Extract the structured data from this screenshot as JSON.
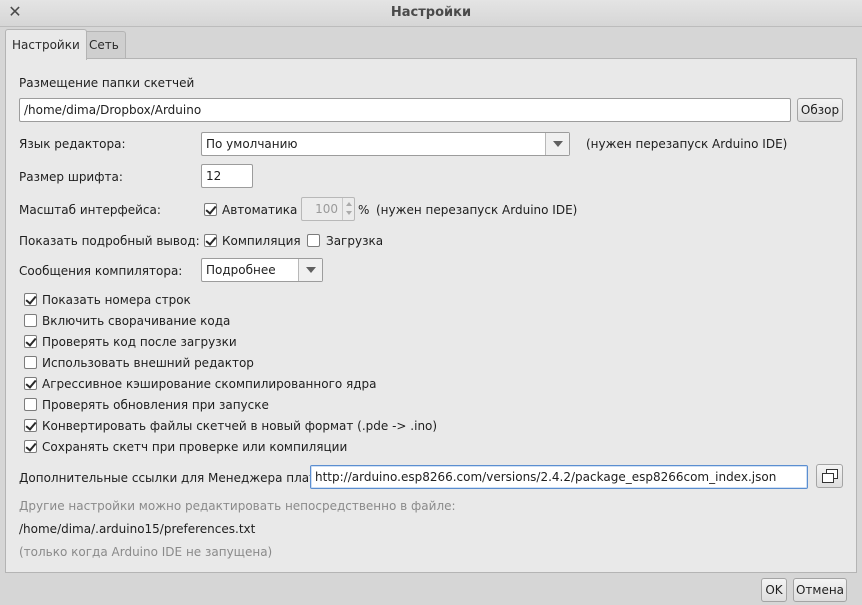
{
  "window": {
    "title": "Настройки"
  },
  "tabs": [
    {
      "label": "Настройки"
    },
    {
      "label": "Сеть"
    }
  ],
  "sketchbook": {
    "label": "Размещение папки скетчей",
    "path": "/home/dima/Dropbox/Arduino",
    "browse_label": "Обзор"
  },
  "editor_language": {
    "label": "Язык редактора:",
    "value": "По умолчанию",
    "note": "(нужен перезапуск Arduino IDE)"
  },
  "font_size": {
    "label": "Размер шрифта:",
    "value": "12"
  },
  "ui_scale": {
    "label": "Масштаб интерфейса:",
    "auto_label": "Автоматика",
    "auto_checked": true,
    "value": "100",
    "unit": "%",
    "note": "(нужен перезапуск Arduino IDE)"
  },
  "verbose": {
    "label": "Показать подробный вывод:",
    "compile_label": "Компиляция",
    "compile_checked": true,
    "upload_label": "Загрузка",
    "upload_checked": false
  },
  "compiler_warnings": {
    "label": "Сообщения компилятора:",
    "value": "Подробнее"
  },
  "options": [
    {
      "label": "Показать номера строк",
      "checked": true
    },
    {
      "label": "Включить сворачивание кода",
      "checked": false
    },
    {
      "label": "Проверять код после загрузки",
      "checked": true
    },
    {
      "label": "Использовать внешний редактор",
      "checked": false
    },
    {
      "label": "Агрессивное кэширование скомпилированного ядра",
      "checked": true
    },
    {
      "label": "Проверять обновления при запуске",
      "checked": false
    },
    {
      "label": "Конвертировать файлы скетчей в новый формат (.pde -> .ino)",
      "checked": true
    },
    {
      "label": "Сохранять скетч при проверке или компиляции",
      "checked": true
    }
  ],
  "board_urls": {
    "label": "Дополнительные ссылки для Менеджера плат:",
    "value": "http://arduino.esp8266.com/versions/2.4.2/package_esp8266com_index.json",
    "button_icon": "open-window-icon"
  },
  "footer_info": {
    "hint": "Другие настройки можно редактировать непосредственно в файле:",
    "prefs_path": "/home/dima/.arduino15/preferences.txt",
    "note": "(только когда Arduino IDE не запущена)"
  },
  "buttons": {
    "ok": "OK",
    "cancel": "Отмена"
  }
}
